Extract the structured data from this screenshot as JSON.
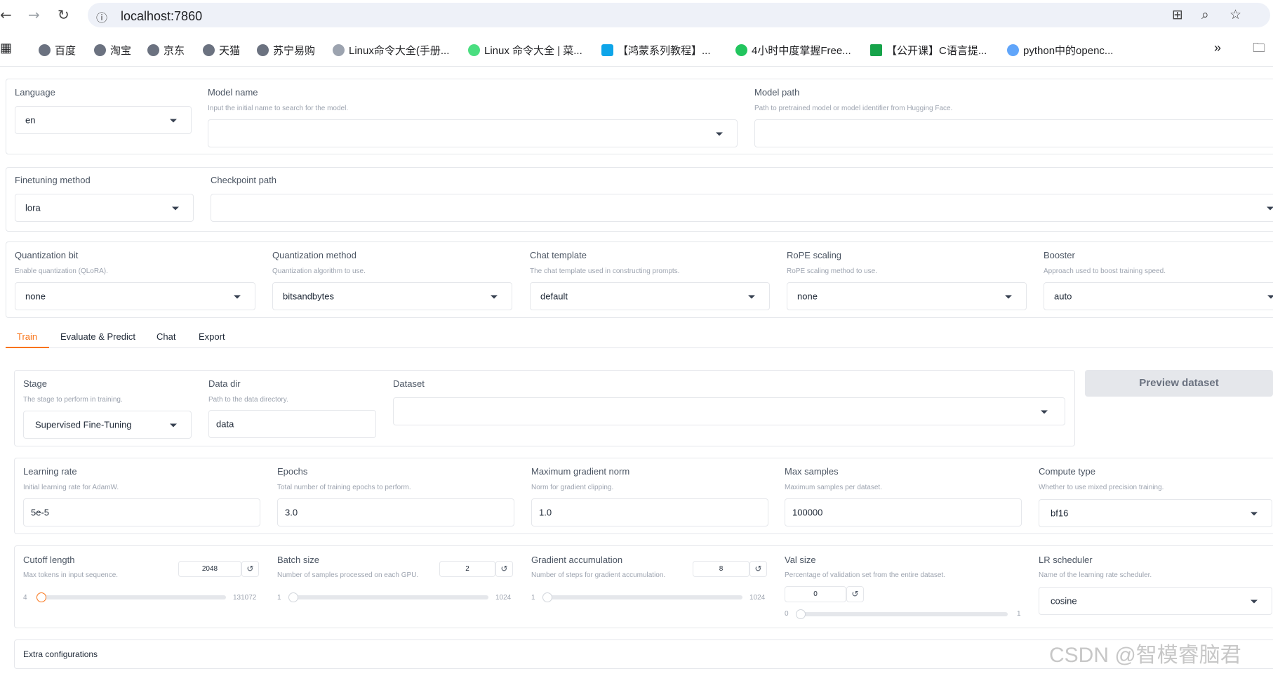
{
  "browser": {
    "url": "localhost:7860",
    "bookmarks": [
      "百度",
      "淘宝",
      "京东",
      "天猫",
      "苏宁易购",
      "Linux命令大全(手册...",
      "Linux 命令大全 | 菜...",
      "【鸿蒙系列教程】...",
      "4小时中度掌握Free...",
      "【公开课】C语言提...",
      "python中的openc..."
    ]
  },
  "top": {
    "language": {
      "label": "Language",
      "value": "en"
    },
    "model_name": {
      "label": "Model name",
      "info": "Input the initial name to search for the model.",
      "value": ""
    },
    "model_path": {
      "label": "Model path",
      "info": "Path to pretrained model or model identifier from Hugging Face.",
      "value": ""
    }
  },
  "finetune": {
    "method": {
      "label": "Finetuning method",
      "value": "lora"
    },
    "checkpoint": {
      "label": "Checkpoint path",
      "value": ""
    }
  },
  "quant": {
    "bit": {
      "label": "Quantization bit",
      "info": "Enable quantization (QLoRA).",
      "value": "none"
    },
    "method": {
      "label": "Quantization method",
      "info": "Quantization algorithm to use.",
      "value": "bitsandbytes"
    },
    "template": {
      "label": "Chat template",
      "info": "The chat template used in constructing prompts.",
      "value": "default"
    },
    "rope": {
      "label": "RoPE scaling",
      "info": "RoPE scaling method to use.",
      "value": "none"
    },
    "booster": {
      "label": "Booster",
      "info": "Approach used to boost training speed.",
      "value": "auto"
    }
  },
  "tabs": [
    "Train",
    "Evaluate & Predict",
    "Chat",
    "Export"
  ],
  "train": {
    "stage": {
      "label": "Stage",
      "info": "The stage to perform in training.",
      "value": "Supervised Fine-Tuning"
    },
    "data_dir": {
      "label": "Data dir",
      "info": "Path to the data directory.",
      "value": "data"
    },
    "dataset": {
      "label": "Dataset",
      "value": ""
    },
    "preview_button": "Preview dataset",
    "lr": {
      "label": "Learning rate",
      "info": "Initial learning rate for AdamW.",
      "value": "5e-5"
    },
    "epochs": {
      "label": "Epochs",
      "info": "Total number of training epochs to perform.",
      "value": "3.0"
    },
    "grad_norm": {
      "label": "Maximum gradient norm",
      "info": "Norm for gradient clipping.",
      "value": "1.0"
    },
    "max_samples": {
      "label": "Max samples",
      "info": "Maximum samples per dataset.",
      "value": "100000"
    },
    "compute_type": {
      "label": "Compute type",
      "info": "Whether to use mixed precision training.",
      "value": "bf16"
    },
    "cutoff": {
      "label": "Cutoff length",
      "info": "Max tokens in input sequence.",
      "value": "2048",
      "min": "4",
      "max": "131072"
    },
    "batch": {
      "label": "Batch size",
      "info": "Number of samples processed on each GPU.",
      "value": "2",
      "min": "1",
      "max": "1024"
    },
    "grad_acc": {
      "label": "Gradient accumulation",
      "info": "Number of steps for gradient accumulation.",
      "value": "8",
      "min": "1",
      "max": "1024"
    },
    "val_size": {
      "label": "Val size",
      "info": "Percentage of validation set from the entire dataset.",
      "value": "0",
      "min": "0",
      "max": "1"
    },
    "lr_sched": {
      "label": "LR scheduler",
      "info": "Name of the learning rate scheduler.",
      "value": "cosine"
    },
    "extra": "Extra configurations"
  },
  "watermark": "CSDN @智模睿脑君",
  "colors": {
    "accent": "#f97316",
    "border": "#e5e7eb",
    "muted": "#9ca3af"
  }
}
